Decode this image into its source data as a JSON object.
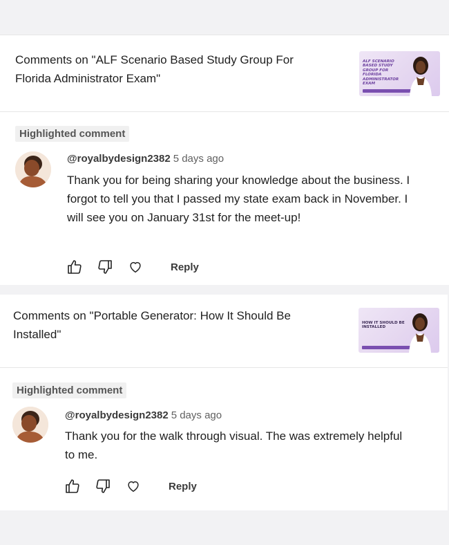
{
  "comments": [
    {
      "context_title": "Comments on \"ALF Scenario Based Study Group For Florida Administrator Exam\"",
      "thumbnail_text": "ALF Scenario Based Study Group For Florida Administrator Exam",
      "highlight_label": "Highlighted comment",
      "author": "@royalbydesign2382",
      "time": "5 days ago",
      "text": "Thank you for being sharing your knowledge about the business. I forgot to tell you that I passed my state exam back in November. I will see you on January 31st for the meet-up!",
      "reply_label": "Reply"
    },
    {
      "context_title": "Comments on \"Portable Generator: How It Should Be Installed\"",
      "thumbnail_text": "How it should be installed",
      "highlight_label": "Highlighted comment",
      "author": "@royalbydesign2382",
      "time": "5 days ago",
      "text": "Thank you for the walk through visual. The was extremely helpful to me.",
      "reply_label": "Reply"
    }
  ],
  "icons": {
    "like": "thumbs-up-icon",
    "dislike": "thumbs-down-icon",
    "heart": "heart-icon"
  },
  "colors": {
    "page_bg": "#f2f2f4",
    "card_bg": "#ffffff",
    "badge_bg": "#f0f0f0",
    "thumb_accent": "#7a4fb0"
  }
}
